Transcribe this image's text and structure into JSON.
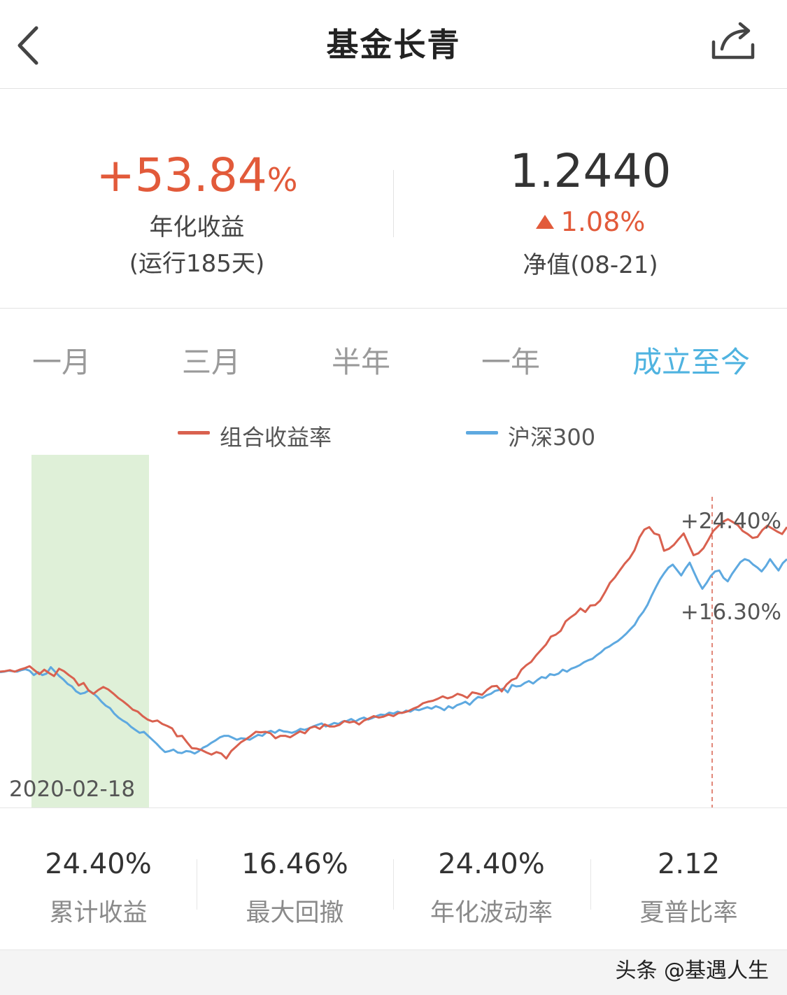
{
  "header": {
    "title": "基金长青",
    "back_icon": "chevron-left-icon",
    "share_icon": "share-icon"
  },
  "summary": {
    "annual_return_value": "+53.84",
    "annual_return_unit": "%",
    "annual_return_label": "年化收益",
    "run_days": "(运行185天)",
    "nav_value": "1.2440",
    "nav_change": "1.08%",
    "nav_label": "净值(08-21)"
  },
  "tabs": [
    {
      "label": "一月",
      "active": false
    },
    {
      "label": "三月",
      "active": false
    },
    {
      "label": "半年",
      "active": false
    },
    {
      "label": "一年",
      "active": false
    },
    {
      "label": "成立至今",
      "active": true
    }
  ],
  "colors": {
    "portfolio": "#d9614f",
    "benchmark": "#5ea9e0",
    "accent": "#4fb3e0",
    "up": "#e25a3a",
    "drawdown_fill": "#dff0d8"
  },
  "chart_data": {
    "type": "line",
    "legend": [
      "组合收益率",
      "沪深300"
    ],
    "series": [
      {
        "name": "组合收益率",
        "values": [
          -6.5,
          -6.4,
          -6.2,
          -6.5,
          -6.1,
          -5.8,
          -5.4,
          -6.2,
          -7.0,
          -6.1,
          -6.8,
          -7.4,
          -5.9,
          -6.4,
          -7.2,
          -7.9,
          -9.3,
          -8.8,
          -10.3,
          -11.0,
          -10.2,
          -9.6,
          -10.1,
          -10.9,
          -11.8,
          -12.5,
          -13.3,
          -14.2,
          -14.6,
          -15.5,
          -16.2,
          -16.6,
          -16.4,
          -17.1,
          -17.5,
          -18.0,
          -19.6,
          -19.5,
          -20.8,
          -22.0,
          -22.1,
          -22.4,
          -22.9,
          -23.3,
          -22.8,
          -23.1,
          -24.1,
          -22.6,
          -21.7,
          -20.8,
          -20.2,
          -19.5,
          -18.7,
          -18.8,
          -18.7,
          -19.0,
          -20.0,
          -19.5,
          -19.5,
          -19.8,
          -19.2,
          -18.6,
          -19.0,
          -17.9,
          -17.6,
          -18.1,
          -17.2,
          -17.6,
          -17.6,
          -17.3,
          -16.5,
          -16.8,
          -16.6,
          -17.2,
          -16.4,
          -16.0,
          -15.5,
          -15.8,
          -15.6,
          -15.2,
          -15.5,
          -14.9,
          -14.8,
          -14.5,
          -14.0,
          -13.6,
          -12.9,
          -12.6,
          -12.4,
          -12.0,
          -11.5,
          -11.9,
          -11.6,
          -11.0,
          -11.3,
          -11.8,
          -10.7,
          -10.9,
          -11.2,
          -10.2,
          -9.5,
          -9.4,
          -10.5,
          -9.1,
          -8.2,
          -7.8,
          -6.1,
          -5.2,
          -4.5,
          -3.2,
          -2.1,
          -1.0,
          0.6,
          1.0,
          1.8,
          3.7,
          4.5,
          5.2,
          6.3,
          5.6,
          6.9,
          7.0,
          7.9,
          9.6,
          11.5,
          12.6,
          14.0,
          15.4,
          16.5,
          18.1,
          20.7,
          22.3,
          22.8,
          21.5,
          21.2,
          18.0,
          18.4,
          19.2,
          20.4,
          21.5,
          19.3,
          17.1,
          17.5,
          18.5,
          20.2,
          22.0,
          23.0,
          23.9,
          24.4,
          23.8,
          23.2,
          22.0,
          21.4,
          20.6,
          20.8,
          22.2,
          23.1,
          22.5,
          21.9,
          21.4,
          22.8
        ]
      },
      {
        "name": "沪深300",
        "values": [
          -6.6,
          -6.5,
          -6.3,
          -6.4,
          -6.5,
          -6.2,
          -6.0,
          -6.3,
          -7.2,
          -6.6,
          -7.2,
          -6.9,
          -5.6,
          -6.5,
          -7.4,
          -8.1,
          -9.0,
          -9.5,
          -10.5,
          -11.0,
          -10.8,
          -10.3,
          -10.9,
          -11.6,
          -12.6,
          -13.4,
          -13.9,
          -15.0,
          -15.8,
          -16.4,
          -16.9,
          -17.7,
          -18.3,
          -18.9,
          -18.7,
          -19.5,
          -20.3,
          -21.1,
          -22.0,
          -22.8,
          -22.6,
          -22.3,
          -22.9,
          -23.0,
          -22.6,
          -22.7,
          -23.1,
          -22.6,
          -21.9,
          -21.5,
          -20.9,
          -20.4,
          -19.8,
          -19.5,
          -19.5,
          -19.9,
          -20.3,
          -20.0,
          -20.1,
          -20.3,
          -19.8,
          -19.3,
          -19.5,
          -18.8,
          -18.5,
          -18.9,
          -18.3,
          -18.6,
          -18.7,
          -18.9,
          -18.6,
          -18.1,
          -18.3,
          -18.0,
          -17.6,
          -17.3,
          -17.0,
          -17.6,
          -17.3,
          -16.9,
          -17.1,
          -16.6,
          -16.5,
          -16.1,
          -16.6,
          -16.1,
          -15.8,
          -16.2,
          -15.9,
          -15.5,
          -15.2,
          -15.3,
          -14.8,
          -15.0,
          -14.6,
          -14.9,
          -14.4,
          -14.6,
          -14.1,
          -14.3,
          -14.0,
          -13.7,
          -14.0,
          -13.5,
          -13.8,
          -14.3,
          -13.5,
          -13.9,
          -13.3,
          -13.0,
          -12.6,
          -13.2,
          -12.3,
          -11.6,
          -11.8,
          -11.3,
          -11.0,
          -10.4,
          -10.2,
          -9.9,
          -10.7,
          -9.2,
          -9.5,
          -9.4,
          -8.8,
          -8.4,
          -8.9,
          -8.2,
          -7.6,
          -7.8,
          -7.0,
          -7.2,
          -6.9,
          -6.1,
          -6.5,
          -5.9,
          -5.6,
          -5.2,
          -4.6,
          -4.2,
          -3.9,
          -3.2,
          -2.6,
          -1.8,
          -1.4,
          -0.8,
          -0.3,
          0.4,
          1.2,
          2.1,
          3.0,
          4.5,
          5.6,
          7.0,
          8.9,
          10.6,
          12.2,
          13.5,
          14.6,
          15.2,
          14.1,
          13.0,
          14.4,
          15.6,
          13.7,
          11.8,
          10.3,
          11.5,
          12.9,
          13.8,
          14.0,
          12.5,
          11.8,
          13.3,
          14.5,
          15.7,
          16.3,
          16.0,
          15.2,
          14.6,
          13.8,
          14.9,
          16.3,
          15.1,
          14.0,
          15.5,
          16.3
        ]
      }
    ],
    "end_labels": [
      "+24.40%",
      "+16.30%"
    ],
    "drawdown_start_label": "2020-02-18",
    "grid": false
  },
  "stats": [
    {
      "value": "24.40%",
      "label": "累计收益"
    },
    {
      "value": "16.46%",
      "label": "最大回撤"
    },
    {
      "value": "24.40%",
      "label": "年化波动率"
    },
    {
      "value": "2.12",
      "label": "夏普比率"
    }
  ],
  "watermark": "头条 @基遇人生"
}
